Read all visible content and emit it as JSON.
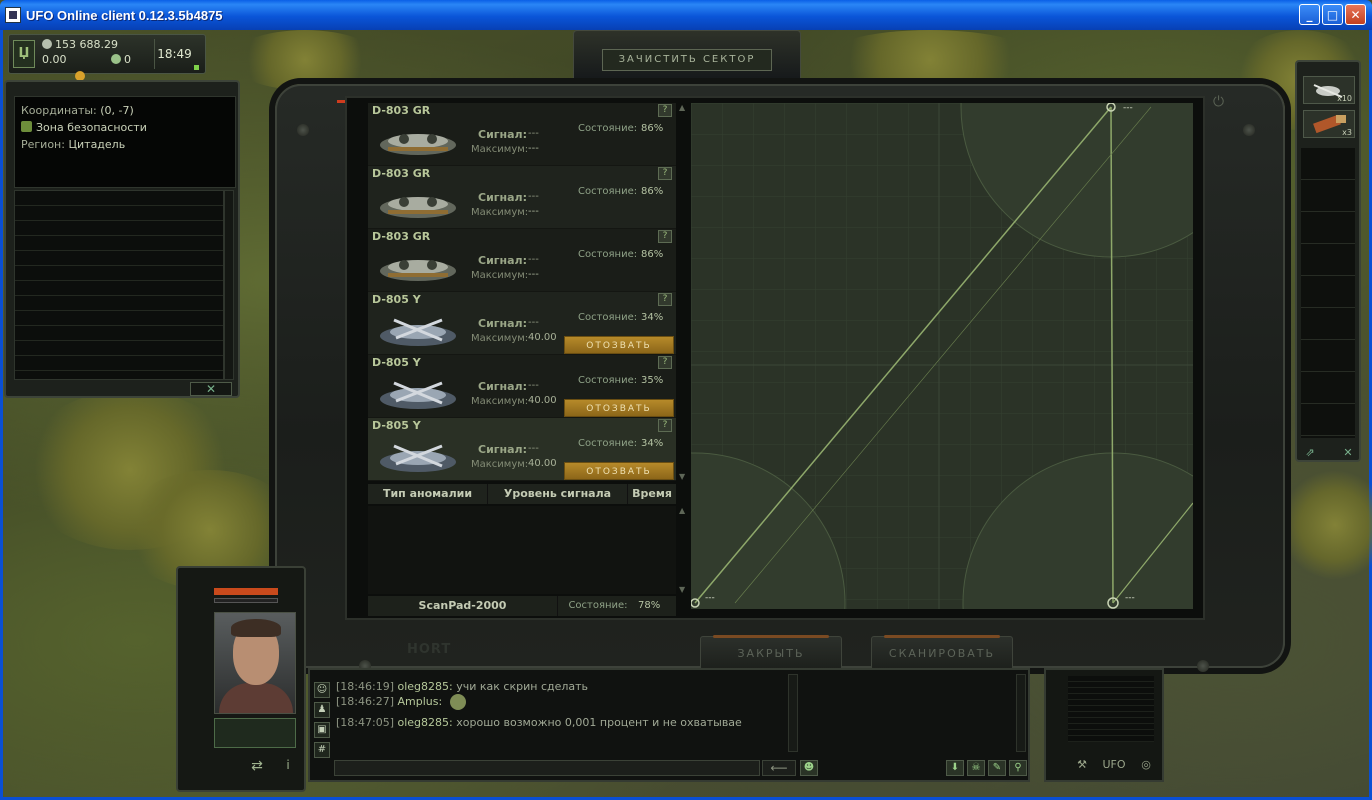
{
  "window": {
    "title": "UFO Online client 0.12.3.5b4875",
    "buttons": {
      "minimize": "_",
      "maximize": "□",
      "close": "✕"
    }
  },
  "hud": {
    "money": "153 688.29",
    "gold": "0.00",
    "tokens": "0",
    "clock": "18:49"
  },
  "top_button": {
    "label": "ЗАЧИСТИТЬ СЕКТОР"
  },
  "info_panel": {
    "coords_label": "Координаты:",
    "coords_value": "(0, -7)",
    "zone": "Зона безопасности",
    "region_label": "Регион:",
    "region_value": "Цитадель",
    "close_symbol": "✕"
  },
  "inventory": {
    "slots": [
      {
        "icon": "drone-item-icon",
        "count": "x10"
      },
      {
        "icon": "ammo-item-icon",
        "count": "x3"
      }
    ]
  },
  "scanner": {
    "labels": {
      "signal": "Сигнал:",
      "max": "Максимум:",
      "state": "Состояние:",
      "recall": "ОТОЗВАТЬ",
      "help": "?"
    },
    "drones": [
      {
        "name": "D-803 GR",
        "signal": "---",
        "max": "---",
        "state": "86%",
        "recall": false,
        "type": "gr"
      },
      {
        "name": "D-803 GR",
        "signal": "---",
        "max": "---",
        "state": "86%",
        "recall": false,
        "type": "gr"
      },
      {
        "name": "D-803 GR",
        "signal": "---",
        "max": "---",
        "state": "86%",
        "recall": false,
        "type": "gr"
      },
      {
        "name": "D-805 Y",
        "signal": "---",
        "max": "40.00",
        "state": "34%",
        "recall": true,
        "type": "y"
      },
      {
        "name": "D-805 Y",
        "signal": "---",
        "max": "40.00",
        "state": "35%",
        "recall": true,
        "type": "y"
      },
      {
        "name": "D-805 Y",
        "signal": "---",
        "max": "40.00",
        "state": "34%",
        "recall": true,
        "type": "y"
      }
    ],
    "anomaly_table": {
      "columns": [
        "Тип аномалии",
        "Уровень сигнала",
        "Время"
      ],
      "rows": []
    },
    "scanpad": {
      "name": "ScanPad-2000",
      "state_label": "Состояние:",
      "state_value": "78%"
    },
    "radar_labels": {
      "top": "---",
      "bottom_left": "---",
      "bottom_right": "---"
    },
    "buttons": {
      "close": "ЗАКРЫТЬ",
      "scan": "СКАНИРОВАТЬ"
    },
    "brand": "HORT"
  },
  "chat": {
    "messages": [
      {
        "time": "[18:46:19]",
        "nick": "oleg8285:",
        "text": "учи как скрин сделать"
      },
      {
        "time": "[18:46:27]",
        "nick": "Amplus:",
        "text": ""
      },
      {
        "time": "[18:47:05]",
        "nick": "oleg8285:",
        "text": "хорошо возможно 0,001 процент и не охватывае"
      }
    ],
    "input_value": "",
    "send_symbol": "⟵"
  },
  "bottom_right": {
    "icons": [
      "wrench-icon",
      "ufo-icon",
      "globe-icon"
    ],
    "ufo_text": "UFO"
  }
}
